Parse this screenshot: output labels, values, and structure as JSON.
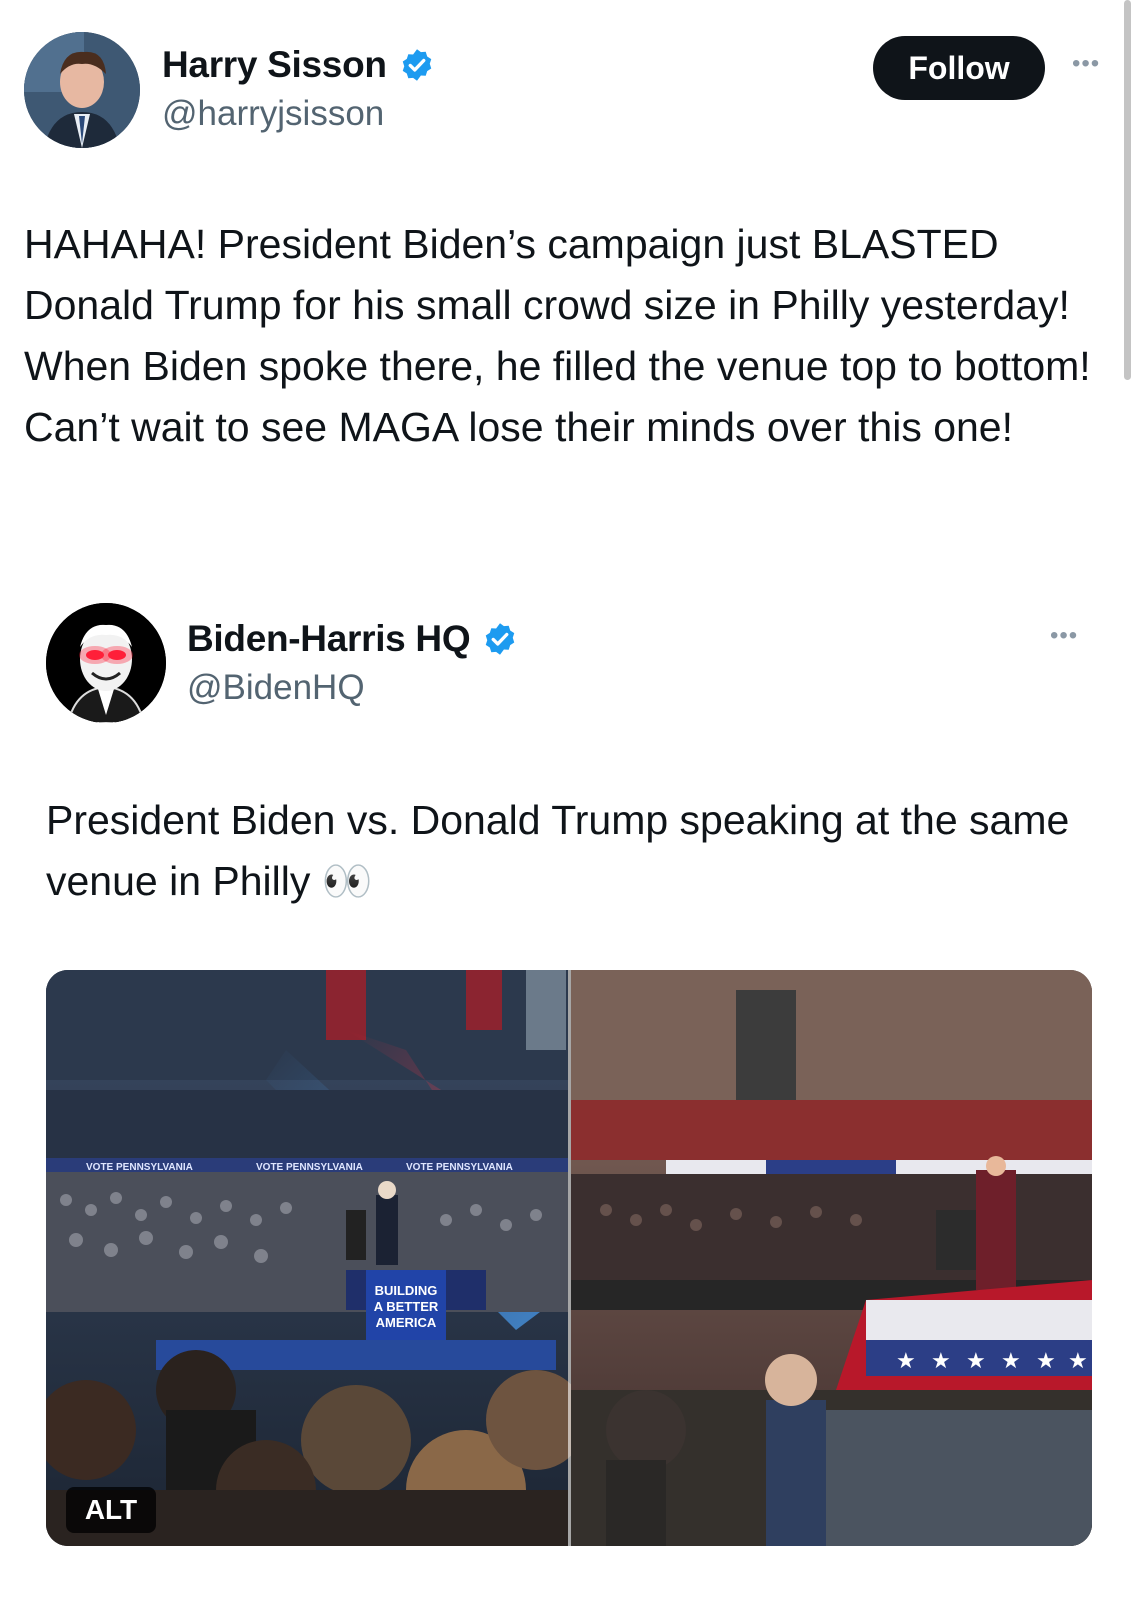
{
  "main_tweet": {
    "author_name": "Harry Sisson",
    "author_handle": "@harryjsisson",
    "follow_label": "Follow",
    "more_label": "•••",
    "text": "HAHAHA! President Biden’s campaign just BLASTED Donald Trump for his small crowd size in Philly yesterday! When Biden spoke there, he filled the venue top to bottom! Can’t wait to see MAGA lose their minds over this one!"
  },
  "quoted_tweet": {
    "author_name": "Biden-Harris HQ",
    "author_handle": "@BidenHQ",
    "more_label": "•••",
    "text": "President Biden vs. Donald Trump speaking at the same venue in Philly 👀",
    "media": {
      "alt_label": "ALT",
      "left_banner": "VOTE PENNSYLVANIA",
      "podium_sign": [
        "BUILDING",
        "A BETTER",
        "AMERICA"
      ]
    }
  },
  "icons": {
    "verified": "verified-badge-icon",
    "more": "more-options-icon"
  },
  "colors": {
    "verified_blue": "#1d9bf0",
    "follow_bg": "#0f1419",
    "secondary_text": "#536471"
  }
}
